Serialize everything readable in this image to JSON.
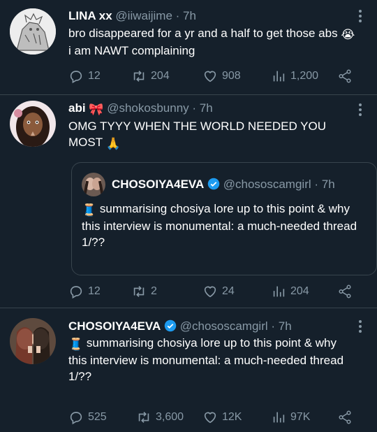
{
  "tweets": [
    {
      "name": "LINA xx",
      "handle": "@iiwaijime",
      "time": "· 7h",
      "text_before": "bro disappeared for a yr and a half to get those abs ",
      "emoji": "😭",
      "text_after": " i am NAWT complaining",
      "stats": {
        "replies": "12",
        "retweets": "204",
        "likes": "908",
        "views": "1,200"
      }
    },
    {
      "name": "abi",
      "name_emoji": "🎀",
      "handle": "@shokosbunny",
      "time": "· 7h",
      "text": "OMG TYYY WHEN THE WORLD NEEDED YOU MOST ",
      "emoji": "🙏",
      "quote": {
        "name": "CHOSOIYA4EVA",
        "handle": "@chososcamgirl",
        "time": "· 7h",
        "emoji": "🧵",
        "text": " summarising chosiya lore up to this point & why this interview is monumental: a much-needed thread 1/??"
      },
      "stats": {
        "replies": "12",
        "retweets": "2",
        "likes": "24",
        "views": "204"
      }
    },
    {
      "name": "CHOSOIYA4EVA",
      "handle": "@chososcamgirl",
      "time": "· 7h",
      "emoji": "🧵",
      "text": " summarising chosiya lore up to this point & why this interview is monumental: a much-needed thread 1/??",
      "stats": {
        "replies": "525",
        "retweets": "3,600",
        "likes": "12K",
        "views": "97K"
      }
    }
  ],
  "colors": {
    "background": "#15202b",
    "muted": "#8899a6",
    "divider": "#38444d",
    "verified": "#1d9bf0"
  },
  "icons": [
    "reply-icon",
    "retweet-icon",
    "like-icon",
    "views-icon",
    "share-icon",
    "more-icon",
    "verified-icon"
  ]
}
